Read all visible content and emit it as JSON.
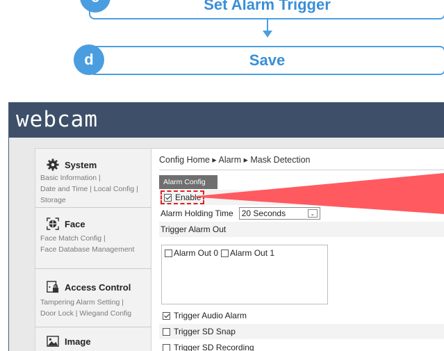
{
  "flow": {
    "step_c": {
      "badge": "c",
      "label": "Set Alarm Trigger"
    },
    "step_d": {
      "badge": "d",
      "label": "Save"
    }
  },
  "app": {
    "logo_text": "webcam"
  },
  "sidebar": {
    "sections": [
      {
        "title": "System",
        "icon": "gear-icon",
        "links": [
          "Basic Information |",
          "Date and Time | Local Config |",
          "Storage"
        ]
      },
      {
        "title": "Face",
        "icon": "face-icon",
        "links": [
          "Face Match Config |",
          "Face Database Management"
        ]
      },
      {
        "title": "Access Control",
        "icon": "door-lock-icon",
        "links": [
          "Tampering Alarm Setting |",
          "Door Lock | Wiegand Config"
        ]
      },
      {
        "title": "Image",
        "icon": "image-icon",
        "links": []
      }
    ]
  },
  "main": {
    "breadcrumb": "Config Home ▸ Alarm ▸ Mask Detection",
    "tab_label": "Alarm Config",
    "enable_label": "Enable",
    "enable_checked": true,
    "holding_time_label": "Alarm Holding Time",
    "holding_time_value": "20 Seconds",
    "trigger_out_label": "Trigger Alarm Out",
    "alarm_out_0": "Alarm Out 0",
    "alarm_out_1": "Alarm Out 1",
    "trigger_audio_label": "Trigger Audio Alarm",
    "trigger_audio_checked": true,
    "trigger_snap_label": "Trigger SD Snap",
    "trigger_snap_checked": false,
    "trigger_recording_label": "Trigger SD Recording",
    "trigger_recording_checked": false
  },
  "colors": {
    "accent_blue": "#4a9ee0",
    "header_bg": "#3e4f69",
    "callout_red": "#ff5a60"
  }
}
